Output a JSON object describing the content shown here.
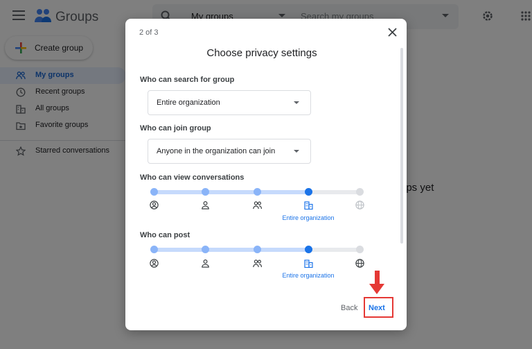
{
  "app": {
    "title": "Groups",
    "search_scope": "My groups",
    "search_placeholder": "Search my groups",
    "create_label": "Create group",
    "empty_text_fragment": "ups yet"
  },
  "nav": {
    "items": [
      {
        "label": "My groups",
        "icon": "people-icon",
        "active": true
      },
      {
        "label": "Recent groups",
        "icon": "clock-icon",
        "active": false
      },
      {
        "label": "All groups",
        "icon": "building-icon",
        "active": false
      },
      {
        "label": "Favorite groups",
        "icon": "folder-star-icon",
        "active": false
      }
    ],
    "starred": {
      "label": "Starred conversations",
      "icon": "star-icon"
    }
  },
  "dialog": {
    "step": "2 of 3",
    "title": "Choose privacy settings",
    "search_label": "Who can search for group",
    "search_value": "Entire organization",
    "join_label": "Who can join group",
    "join_value": "Anyone in the organization can join",
    "view_label": "Who can view conversations",
    "view_level_index": 3,
    "view_selected_label": "Entire organization",
    "post_label": "Who can post",
    "post_level_index": 3,
    "post_selected_label": "Entire organization",
    "option_icons": [
      "account-circle-icon",
      "person-icon",
      "people-icon",
      "building-icon",
      "globe-icon"
    ],
    "back_label": "Back",
    "next_label": "Next"
  },
  "colors": {
    "accent": "#1a73e8",
    "highlight": "#e53935",
    "track_fill": "#c6dafc"
  }
}
